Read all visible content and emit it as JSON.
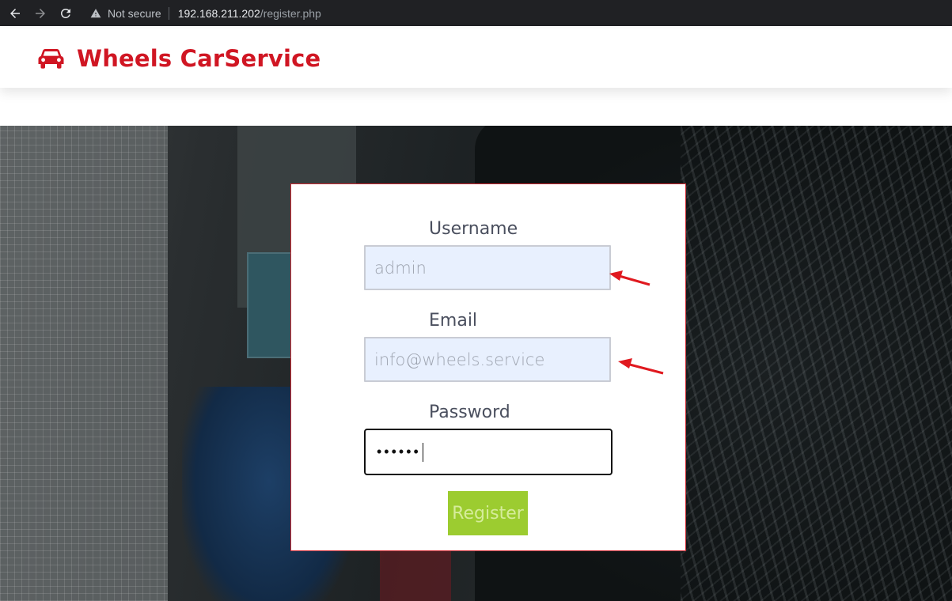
{
  "browser": {
    "security_label": "Not secure",
    "url_host": "192.168.211.202",
    "url_path": "/register.php",
    "icons": [
      "back-arrow-icon",
      "forward-arrow-icon",
      "reload-icon",
      "warning-triangle-icon"
    ]
  },
  "header": {
    "brand_name": "Wheels CarService",
    "brand_icon": "car-icon",
    "brand_color": "#d01623"
  },
  "form": {
    "username_label": "Username",
    "username_value": "admin",
    "email_label": "Email",
    "email_value": "info@wheels.service",
    "password_label": "Password",
    "password_masked": "••••••",
    "register_label": "Register",
    "button_color": "#9ccc30",
    "border_color": "#cf2a33"
  },
  "annotations": {
    "arrow_color": "#e0191f"
  }
}
